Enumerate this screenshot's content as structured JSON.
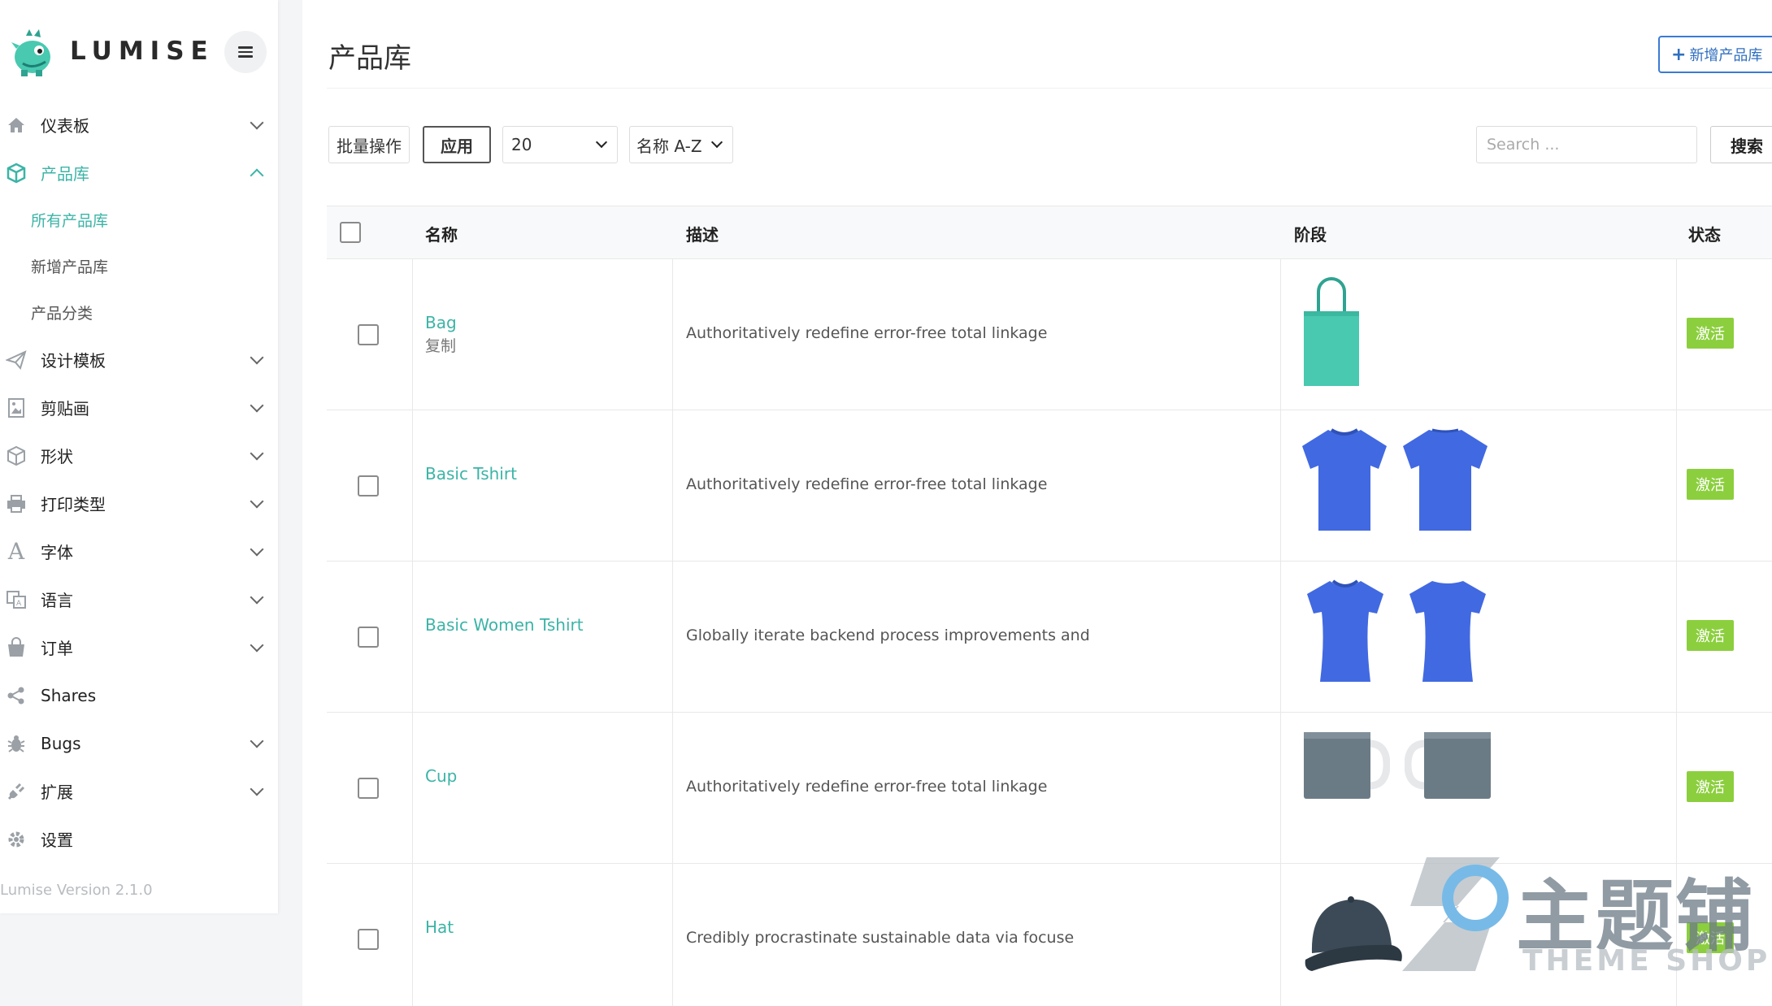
{
  "brand": {
    "name": "LUMISE"
  },
  "sidebar": {
    "items": [
      {
        "label": "仪表板",
        "icon": "home-icon"
      },
      {
        "label": "产品库",
        "icon": "cube-icon"
      },
      {
        "label": "设计模板",
        "icon": "paper-plane-icon"
      },
      {
        "label": "剪贴画",
        "icon": "image-icon"
      },
      {
        "label": "形状",
        "icon": "box-icon"
      },
      {
        "label": "打印类型",
        "icon": "printer-icon"
      },
      {
        "label": "字体",
        "icon": "font-icon"
      },
      {
        "label": "语言",
        "icon": "language-icon"
      },
      {
        "label": "订单",
        "icon": "shopping-bag-icon"
      },
      {
        "label": "Shares",
        "icon": "share-icon"
      },
      {
        "label": "Bugs",
        "icon": "bug-icon"
      },
      {
        "label": "扩展",
        "icon": "plug-icon"
      },
      {
        "label": "设置",
        "icon": "gear-icon"
      }
    ],
    "sub_items": [
      "所有产品库",
      "新增产品库",
      "产品分类"
    ],
    "version": "Lumise Version 2.1.0"
  },
  "page": {
    "title": "产品库",
    "add_button": "新增产品库"
  },
  "toolbar": {
    "bulk_label": "批量操作",
    "apply_label": "应用",
    "per_page": "20",
    "sort_by": "名称 A-Z",
    "search_placeholder": "Search ...",
    "search_button": "搜索"
  },
  "table": {
    "columns": [
      "名称",
      "描述",
      "阶段",
      "状态"
    ],
    "rows": [
      {
        "name": "Bag",
        "sub": "复制",
        "description": "Authoritatively redefine error-free total linkage",
        "status": "激活"
      },
      {
        "name": "Basic Tshirt",
        "sub": "",
        "description": "Authoritatively redefine error-free total linkage",
        "status": "激活"
      },
      {
        "name": "Basic Women Tshirt",
        "sub": "",
        "description": "Globally iterate backend process improvements and",
        "status": "激活"
      },
      {
        "name": "Cup",
        "sub": "",
        "description": "Authoritatively redefine error-free total linkage",
        "status": "激活"
      },
      {
        "name": "Hat",
        "sub": "",
        "description": "Credibly procrastinate sustainable data via focuse",
        "status": "激活"
      }
    ]
  },
  "watermark": {
    "cn": "主题铺",
    "en": "THEME SHOP"
  },
  "colors": {
    "accent": "#3bb4a6",
    "status": "#8ccf3e",
    "primary": "#3a7bd5",
    "shirt": "#4169e1",
    "bag": "#48c9b0",
    "mug": "#6b7b86"
  }
}
